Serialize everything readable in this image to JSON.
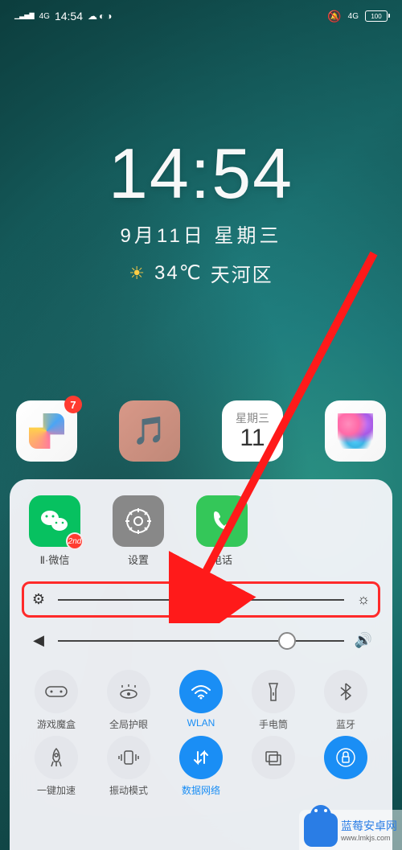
{
  "status": {
    "signal": "4G",
    "time": "14:54",
    "mute_icon": "bell-off",
    "net_right": "4G",
    "battery": "100"
  },
  "clock": {
    "time": "14:54",
    "date": "9月11日   星期三",
    "temp": "34℃",
    "location": "天河区"
  },
  "home_apps": {
    "store_badge": "7",
    "cal_weekday": "星期三",
    "cal_day": "11"
  },
  "panel_apps": {
    "wechat": {
      "label": "Ⅱ·微信",
      "badge": "2nd"
    },
    "settings": {
      "label": "设置"
    },
    "phone": {
      "label": "电话"
    }
  },
  "sliders": {
    "brightness": {
      "value": 42
    },
    "volume": {
      "value": 80
    }
  },
  "toggles": {
    "row1": [
      {
        "icon": "gamepad",
        "label": "游戏魔盒",
        "active": false
      },
      {
        "icon": "eye",
        "label": "全局护眼",
        "active": false
      },
      {
        "icon": "wifi",
        "label": "WLAN",
        "active": true
      },
      {
        "icon": "flashlight",
        "label": "手电筒",
        "active": false
      },
      {
        "icon": "bluetooth",
        "label": "蓝牙",
        "active": false
      }
    ],
    "row2": [
      {
        "icon": "rocket",
        "label": "一键加速",
        "active": false
      },
      {
        "icon": "vibrate",
        "label": "振动模式",
        "active": false
      },
      {
        "icon": "data",
        "label": "数据网络",
        "active": true
      },
      {
        "icon": "screenshot",
        "label": "",
        "active": false
      },
      {
        "icon": "lock",
        "label": "",
        "active": true
      }
    ]
  },
  "watermark": {
    "text": "蓝莓安卓网",
    "url": "www.lmkjs.com"
  }
}
